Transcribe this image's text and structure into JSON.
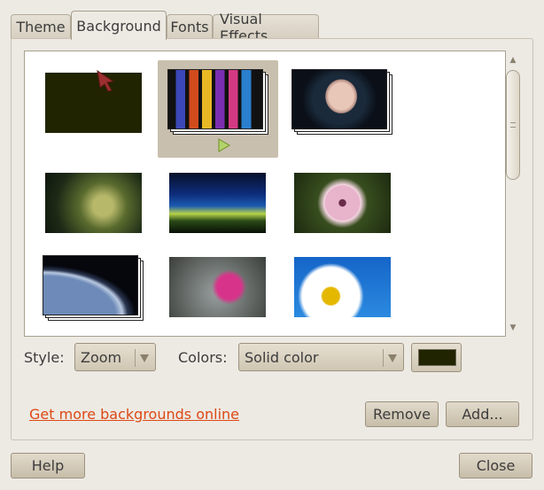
{
  "tabs": [
    {
      "label": "Theme"
    },
    {
      "label": "Background"
    },
    {
      "label": "Fonts"
    },
    {
      "label": "Visual Effects"
    }
  ],
  "active_tab": "Background",
  "gallery": {
    "selected_index": 1,
    "items": [
      {
        "name": "solid-color"
      },
      {
        "name": "colorful-slideshow"
      },
      {
        "name": "woman-portrait"
      },
      {
        "name": "tree-branches"
      },
      {
        "name": "blue-light-rays"
      },
      {
        "name": "pink-daisy"
      },
      {
        "name": "planet-earth"
      },
      {
        "name": "pink-flowers"
      },
      {
        "name": "white-daisy-blue-sky"
      }
    ]
  },
  "style": {
    "label": "Style:",
    "value": "Zoom"
  },
  "colors": {
    "label": "Colors:",
    "value": "Solid color",
    "swatch": "#212400"
  },
  "link_text": "Get more backgrounds online",
  "buttons": {
    "remove": "Remove",
    "add": "Add...",
    "help": "Help",
    "close": "Close"
  },
  "colors_theme": {
    "link": "#dd4814",
    "selection": "#c9bfae",
    "background": "#edeae4"
  }
}
